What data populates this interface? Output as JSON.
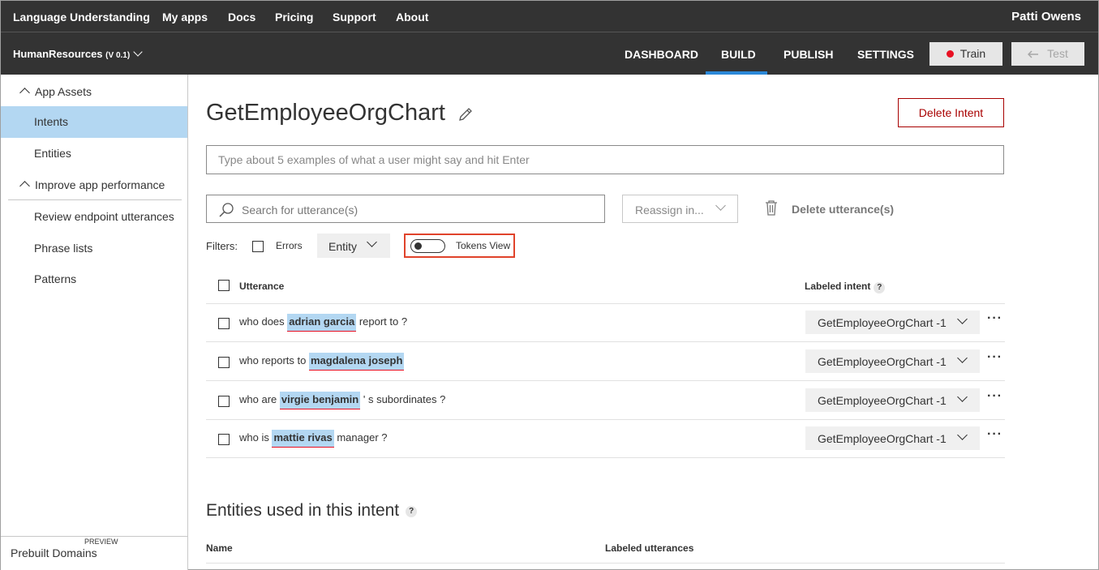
{
  "topnav": {
    "brand": "Language Understanding",
    "links": [
      "My apps",
      "Docs",
      "Pricing",
      "Support",
      "About"
    ],
    "user": "Patti Owens"
  },
  "appbar": {
    "app_name": "HumanResources",
    "version": "(V 0.1)",
    "tabs": [
      "DASHBOARD",
      "BUILD",
      "PUBLISH",
      "SETTINGS"
    ],
    "active_tab": "BUILD",
    "train_label": "Train",
    "test_label": "Test"
  },
  "sidebar": {
    "group1": "App Assets",
    "items1": [
      "Intents",
      "Entities"
    ],
    "group2": "Improve app performance",
    "items2": [
      "Review endpoint utterances",
      "Phrase lists",
      "Patterns"
    ],
    "bottom_label": "Prebuilt Domains",
    "bottom_badge": "PREVIEW"
  },
  "main": {
    "intent_title": "GetEmployeeOrgChart",
    "delete_intent": "Delete Intent",
    "utterance_placeholder": "Type about 5 examples of what a user might say and hit Enter",
    "search_placeholder": "Search for utterance(s)",
    "reassign_label": "Reassign in...",
    "delete_utterances": "Delete utterance(s)",
    "filters_label": "Filters:",
    "errors_label": "Errors",
    "entity_label": "Entity",
    "tokens_view_label": "Tokens View",
    "col_utterance": "Utterance",
    "col_labeled_intent": "Labeled intent",
    "help": "?"
  },
  "utterances": [
    {
      "pre": "who does ",
      "entity": "adrian garcia",
      "post": " report to ?",
      "intent": "GetEmployeeOrgChart -1"
    },
    {
      "pre": "who reports to ",
      "entity": "magdalena joseph",
      "post": "",
      "intent": "GetEmployeeOrgChart -1"
    },
    {
      "pre": "who are ",
      "entity": "virgie benjamin",
      "post": " ' s subordinates ?",
      "intent": "GetEmployeeOrgChart -1"
    },
    {
      "pre": "who is ",
      "entity": "mattie rivas",
      "post": " manager ?",
      "intent": "GetEmployeeOrgChart -1"
    }
  ],
  "entities_section": {
    "title": "Entities used in this intent",
    "col_name": "Name",
    "col_labeled": "Labeled utterances"
  },
  "more_label": "···",
  "colors": {
    "topbar": "#333333",
    "accent": "#2b88d8",
    "active_sidebar": "#b3d7f2",
    "delete_red": "#a80000",
    "highlight_box": "#e0432b"
  }
}
